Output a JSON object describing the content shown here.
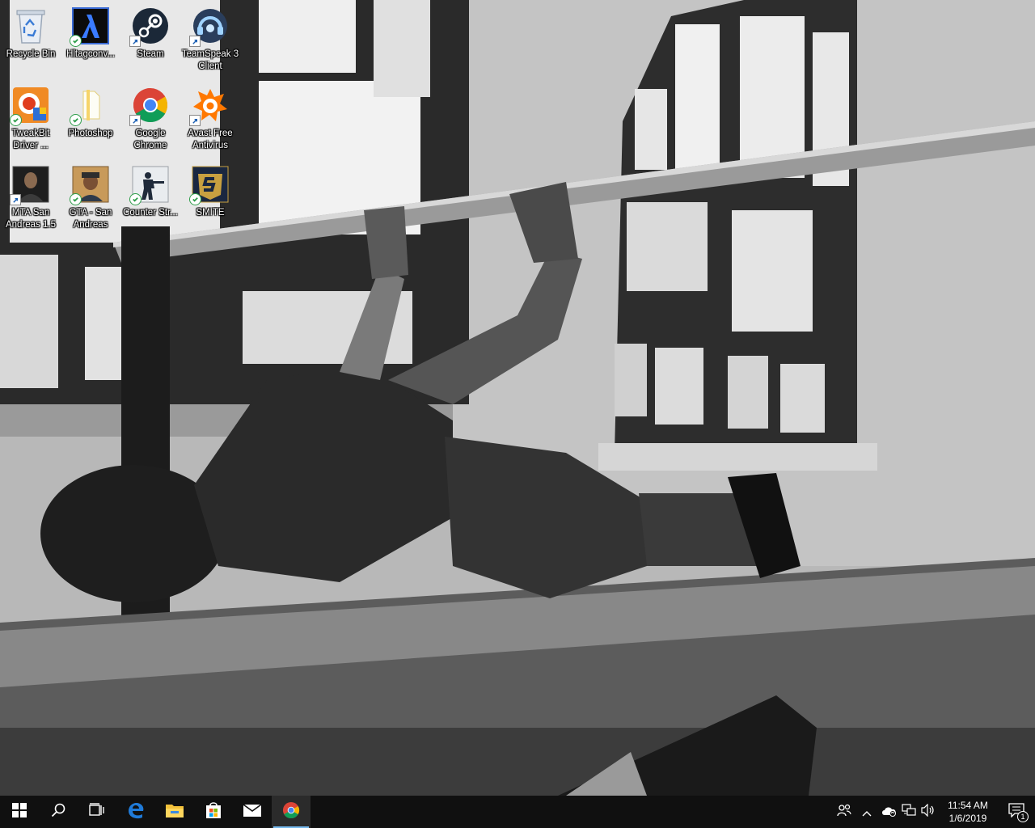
{
  "desktop": {
    "icons": [
      {
        "label": "Recycle Bin",
        "icon": "recycle-bin-icon"
      },
      {
        "label": "Hltagconv...",
        "icon": "half-life-icon"
      },
      {
        "label": "Steam",
        "icon": "steam-icon"
      },
      {
        "label": "TeamSpeak 3 Client",
        "icon": "teamspeak-icon"
      },
      {
        "label": "TweakBit Driver ...",
        "icon": "tweakbit-icon"
      },
      {
        "label": "Photoshop",
        "icon": "folder-icon"
      },
      {
        "label": "Google Chrome",
        "icon": "chrome-icon"
      },
      {
        "label": "Avast Free Antivirus",
        "icon": "avast-icon"
      },
      {
        "label": "MTA San Andreas 1.5",
        "icon": "mta-icon"
      },
      {
        "label": "GTA - San Andreas",
        "icon": "gta-sa-icon"
      },
      {
        "label": "Counter Str...",
        "icon": "counter-strike-icon"
      },
      {
        "label": "SMITE",
        "icon": "smite-icon"
      }
    ]
  },
  "taskbar": {
    "buttons": [
      {
        "icon": "windows-start-icon"
      },
      {
        "icon": "search-icon"
      },
      {
        "icon": "task-view-icon"
      },
      {
        "icon": "edge-icon"
      },
      {
        "icon": "file-explorer-icon"
      },
      {
        "icon": "store-icon"
      },
      {
        "icon": "mail-icon"
      },
      {
        "icon": "chrome-icon",
        "active": true
      }
    ],
    "tray": {
      "icons": [
        "people-icon",
        "chevron-up-icon",
        "onedrive-sync-icon",
        "network-icon",
        "volume-icon"
      ],
      "time": "11:54 AM",
      "date": "1/6/2019",
      "notification_count": "1"
    }
  }
}
